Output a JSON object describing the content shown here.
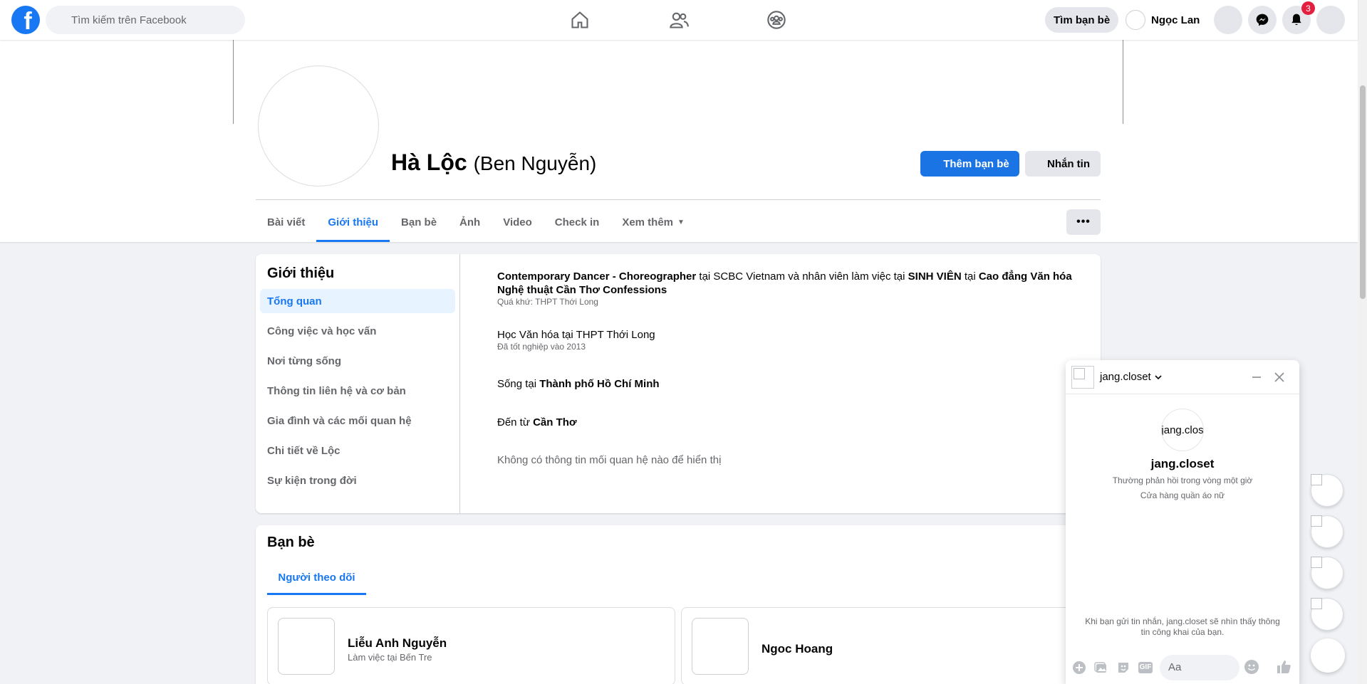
{
  "topbar": {
    "search_placeholder": "Tìm kiếm trên Facebook",
    "find_friends_label": "Tìm bạn bè",
    "user_name": "Ngọc Lan",
    "notification_count": "3",
    "logo_letter": "f"
  },
  "profile": {
    "name": "Hà Lộc",
    "alternate_name": "(Ben Nguyễn)",
    "add_friend_label": "Thêm bạn bè",
    "message_label": "Nhắn tin",
    "more_label": "•••"
  },
  "tabs": [
    {
      "label": "Bài viết"
    },
    {
      "label": "Giới thiệu",
      "active": true
    },
    {
      "label": "Bạn bè"
    },
    {
      "label": "Ảnh"
    },
    {
      "label": "Video"
    },
    {
      "label": "Check in"
    },
    {
      "label": "Xem thêm"
    }
  ],
  "about": {
    "title": "Giới thiệu",
    "menu": [
      "Tổng quan",
      "Công việc và học vấn",
      "Nơi từng sống",
      "Thông tin liên hệ và cơ bản",
      "Gia đình và các mối quan hệ",
      "Chi tiết về Lộc",
      "Sự kiện trong đời"
    ],
    "work": {
      "role": "Contemporary Dancer - Choreographer",
      "at1": "tại",
      "company": "SCBC Vietnam",
      "and": "và nhân viên làm việc tại",
      "org": "SINH VIÊN",
      "at2": "tại",
      "place": "Cao đẳng Văn hóa Nghệ thuật Cần Thơ Confessions",
      "past": "Quá khứ: THPT Thới Long"
    },
    "education": {
      "text": "Học Văn hóa tại THPT Thới Long",
      "sub": "Đã tốt nghiệp vào 2013"
    },
    "lives": {
      "prefix": "Sống tại",
      "place": "Thành phố Hồ Chí Minh"
    },
    "from": {
      "prefix": "Đến từ",
      "place": "Cần Thơ"
    },
    "relationship": "Không có thông tin mối quan hệ nào để hiển thị"
  },
  "friends": {
    "title": "Bạn bè",
    "tab": "Người theo dõi",
    "items": [
      {
        "name": "Liễu Anh Nguyễn",
        "sub": "Làm việc tại Bến Tre"
      },
      {
        "name": "Ngoc Hoang",
        "sub": ""
      }
    ]
  },
  "chat": {
    "header_name": "jang.closet",
    "avatar_text": "jang.clos",
    "name": "jang.closet",
    "response": "Thường phản hồi trong vòng một giờ",
    "category": "Cửa hàng quần áo nữ",
    "notice": "Khi bạn gửi tin nhắn, jang.closet sẽ nhìn thấy thông tin công khai của bạn.",
    "input_placeholder": "Aa",
    "gif_label": "GIF"
  },
  "colors": {
    "brand": "#1877f2",
    "badge": "#e41e3f",
    "background": "#f0f2f5"
  },
  "icons": [
    "home-icon",
    "friends-icon",
    "groups-icon",
    "menu-icon",
    "messenger-icon",
    "bell-icon",
    "account-icon"
  ]
}
